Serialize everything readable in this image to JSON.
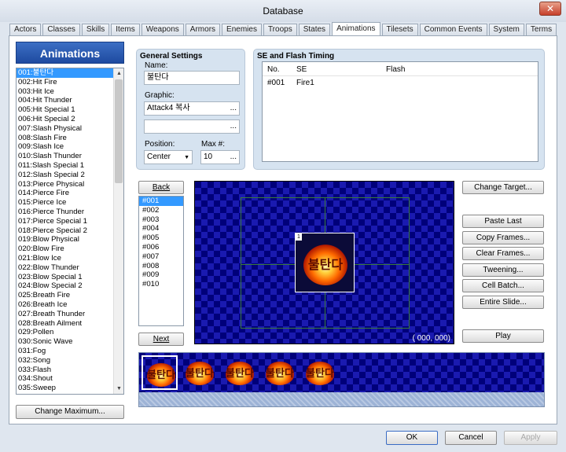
{
  "window": {
    "title": "Database",
    "close": "✕"
  },
  "tabs": [
    "Actors",
    "Classes",
    "Skills",
    "Items",
    "Weapons",
    "Armors",
    "Enemies",
    "Troops",
    "States",
    "Animations",
    "Tilesets",
    "Common Events",
    "System",
    "Terms"
  ],
  "active_tab": "Animations",
  "sidebar": {
    "header": "Animations",
    "items": [
      "001:불탄다",
      "002:Hit Fire",
      "003:Hit Ice",
      "004:Hit Thunder",
      "005:Hit Special 1",
      "006:Hit Special 2",
      "007:Slash Physical",
      "008:Slash Fire",
      "009:Slash Ice",
      "010:Slash Thunder",
      "011:Slash Special 1",
      "012:Slash Special 2",
      "013:Pierce Physical",
      "014:Pierce Fire",
      "015:Pierce Ice",
      "016:Pierce Thunder",
      "017:Pierce Special 1",
      "018:Pierce Special 2",
      "019:Blow Physical",
      "020:Blow Fire",
      "021:Blow Ice",
      "022:Blow Thunder",
      "023:Blow Special 1",
      "024:Blow Special 2",
      "025:Breath Fire",
      "026:Breath Ice",
      "027:Breath Thunder",
      "028:Breath Ailment",
      "029:Pollen",
      "030:Sonic Wave",
      "031:Fog",
      "032:Song",
      "033:Flash",
      "034:Shout",
      "035:Sweep"
    ],
    "scroll_up": "▲",
    "scroll_down": "▼",
    "change_maximum": "Change Maximum..."
  },
  "general": {
    "title": "General Settings",
    "name_label": "Name:",
    "name_value": "불탄다",
    "graphic_label": "Graphic:",
    "graphic_value": "Attack4 복사",
    "graphic2_value": "",
    "position_label": "Position:",
    "position_value": "Center",
    "max_label": "Max #:",
    "max_value": "10",
    "dots": "...",
    "dropdown": "▼"
  },
  "se_flash": {
    "title": "SE and Flash Timing",
    "columns": [
      "No.",
      "SE",
      "Flash"
    ],
    "rows": [
      [
        "#001",
        "Fire1",
        ""
      ]
    ]
  },
  "frames": {
    "back": "Back",
    "next": "Next",
    "items": [
      "#001",
      "#002",
      "#003",
      "#004",
      "#005",
      "#006",
      "#007",
      "#008",
      "#009",
      "#010"
    ]
  },
  "canvas": {
    "coords": "( 000, 000)",
    "cell_index": "1",
    "overlay_text": "불탄다"
  },
  "actions": [
    "Change Target...",
    "Paste Last",
    "Copy Frames...",
    "Clear Frames...",
    "Tweening...",
    "Cell Batch...",
    "Entire Slide...",
    "Play"
  ],
  "filmstrip": {
    "cells": [
      "불탄다",
      "불탄다",
      "불탄다",
      "불탄다",
      "불탄다"
    ]
  },
  "footer": {
    "ok": "OK",
    "cancel": "Cancel",
    "apply": "Apply"
  },
  "colors": {
    "selection": "#3399ff",
    "header": "#1e4aa0",
    "canvas_bg": "#00007a"
  }
}
